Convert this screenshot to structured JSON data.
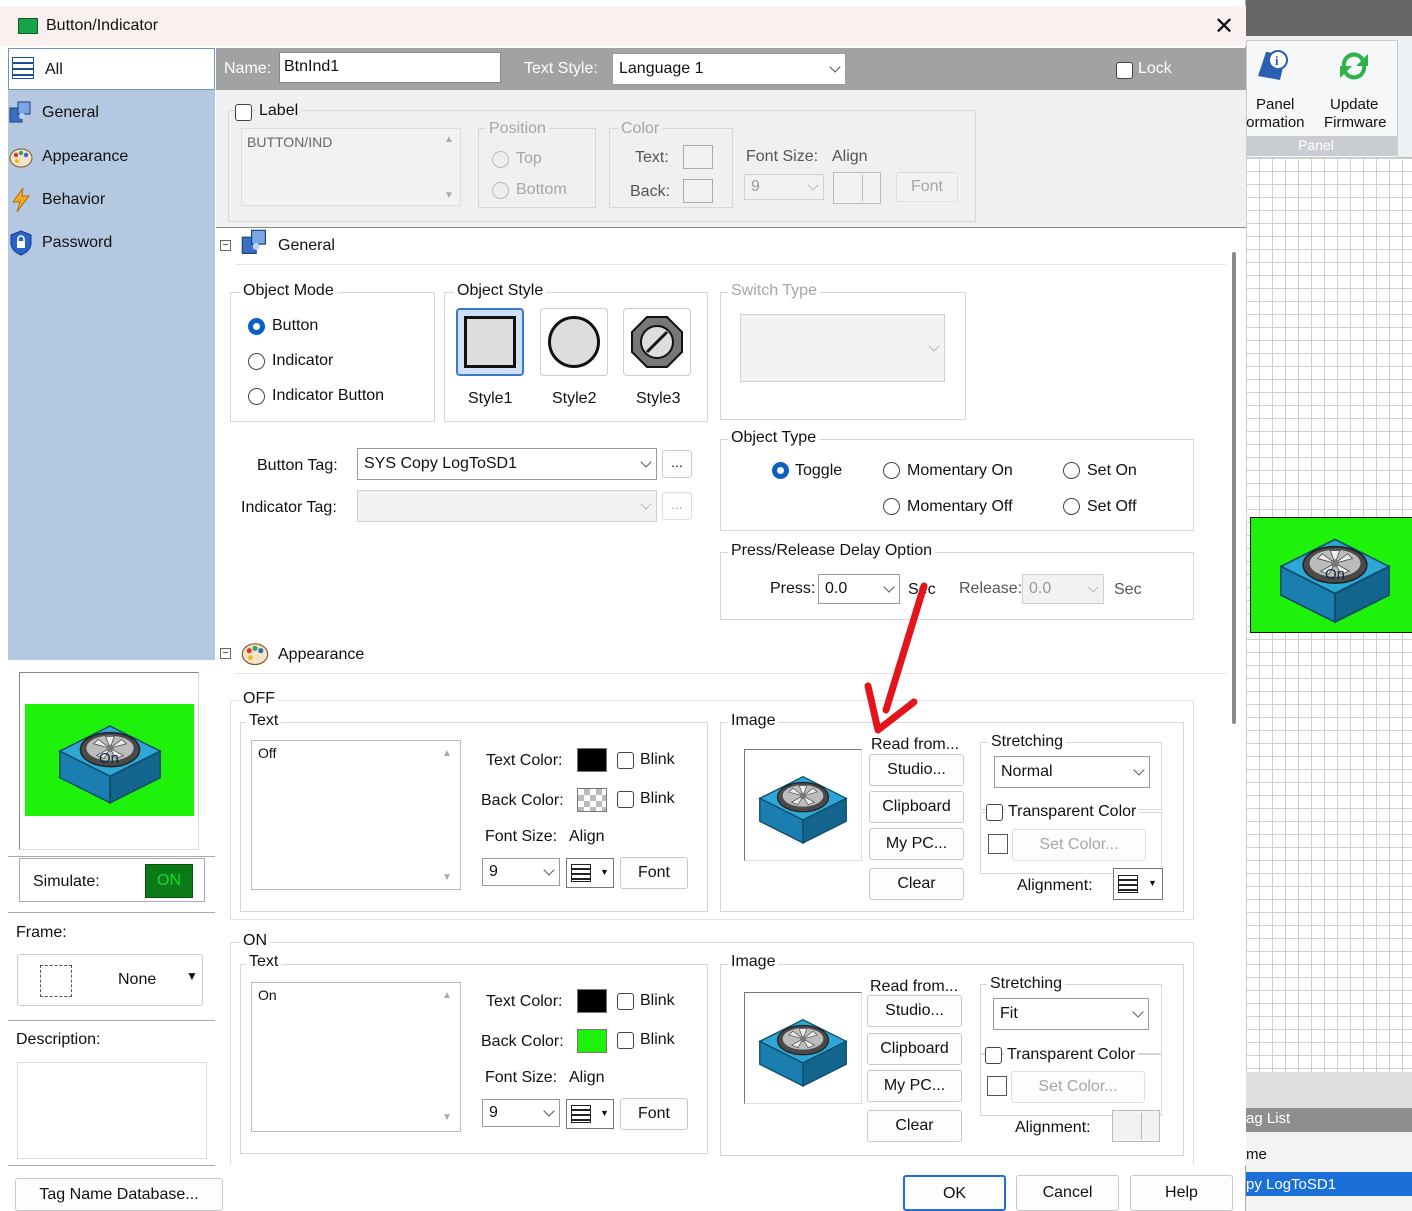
{
  "window": {
    "title": "Button/Indicator"
  },
  "sidebar": {
    "items": [
      {
        "label": "All"
      },
      {
        "label": "General"
      },
      {
        "label": "Appearance"
      },
      {
        "label": "Behavior"
      },
      {
        "label": "Password"
      }
    ]
  },
  "simulate": {
    "label": "Simulate:",
    "value": "ON"
  },
  "frame": {
    "label": "Frame:",
    "value": "None"
  },
  "description": {
    "label": "Description:"
  },
  "tag_db_button": "Tag Name Database...",
  "topbar": {
    "name_label": "Name:",
    "name_value": "BtnInd1",
    "text_style_label": "Text Style:",
    "text_style_value": "Language 1",
    "lock_label": "Lock"
  },
  "label_section": {
    "label_cb": "Label",
    "text": "BUTTON/IND",
    "position": "Position",
    "top": "Top",
    "bottom": "Bottom",
    "color": "Color",
    "text_label": "Text:",
    "back_label": "Back:",
    "font_size": "Font Size:",
    "align": "Align",
    "size_value": "9",
    "font_button": "Font"
  },
  "general": {
    "header": "General",
    "object_mode": "Object Mode",
    "modes": [
      "Button",
      "Indicator",
      "Indicator Button"
    ],
    "object_style": "Object Style",
    "styles": [
      "Style1",
      "Style2",
      "Style3"
    ],
    "switch_type": "Switch Type",
    "button_tag_label": "Button Tag:",
    "button_tag_value": "SYS Copy LogToSD1",
    "indicator_tag_label": "Indicator Tag:",
    "ellipsis": "...",
    "object_type": "Object Type",
    "types": [
      "Toggle",
      "Momentary On",
      "Set On",
      "Momentary Off",
      "Set Off"
    ],
    "press_release": "Press/Release Delay Option",
    "press_label": "Press:",
    "press_value": "0.0",
    "sec": "Sec",
    "release_label": "Release:",
    "release_value": "0.0"
  },
  "appearance": {
    "header": "Appearance",
    "off": {
      "title": "OFF",
      "text_group": "Text",
      "text": "Off",
      "text_color": "Text Color:",
      "back_color": "Back Color:",
      "blink": "Blink",
      "font_size": "Font Size:",
      "align": "Align",
      "size": "9",
      "font_button": "Font",
      "image_group": "Image",
      "read_from": "Read from...",
      "studio": "Studio...",
      "clipboard": "Clipboard",
      "mypc": "My PC...",
      "clear": "Clear",
      "stretching": "Stretching",
      "stretch_value": "Normal",
      "transparent": "Transparent Color",
      "set_color": "Set Color...",
      "alignment": "Alignment:",
      "overlay": "On"
    },
    "on": {
      "title": "ON",
      "text_group": "Text",
      "text": "On",
      "text_color": "Text Color:",
      "back_color": "Back Color:",
      "blink": "Blink",
      "font_size": "Font Size:",
      "align": "Align",
      "size": "9",
      "font_button": "Font",
      "image_group": "Image",
      "read_from": "Read from...",
      "studio": "Studio...",
      "clipboard": "Clipboard",
      "mypc": "My PC...",
      "clear": "Clear",
      "stretching": "Stretching",
      "stretch_value": "Fit",
      "transparent": "Transparent Color",
      "set_color": "Set Color...",
      "alignment": "Alignment:"
    }
  },
  "footer": {
    "ok": "OK",
    "cancel": "Cancel",
    "help": "Help"
  },
  "background_app": {
    "ribbon_panel": "Panel",
    "ribbon_info": "formation",
    "ribbon_update": "Update",
    "ribbon_firmware": "Firmware",
    "ribbon_group": "Panel",
    "taglist_title": "ag List",
    "taglist_col": "me",
    "taglist_row": "py LogToSD1",
    "preview_overlay": "On"
  },
  "colors": {
    "accent": "#0a5fbf",
    "green": "#1ff20a",
    "sidebar_blue": "#b4c8e2",
    "header_gray": "#a2a2a2"
  }
}
